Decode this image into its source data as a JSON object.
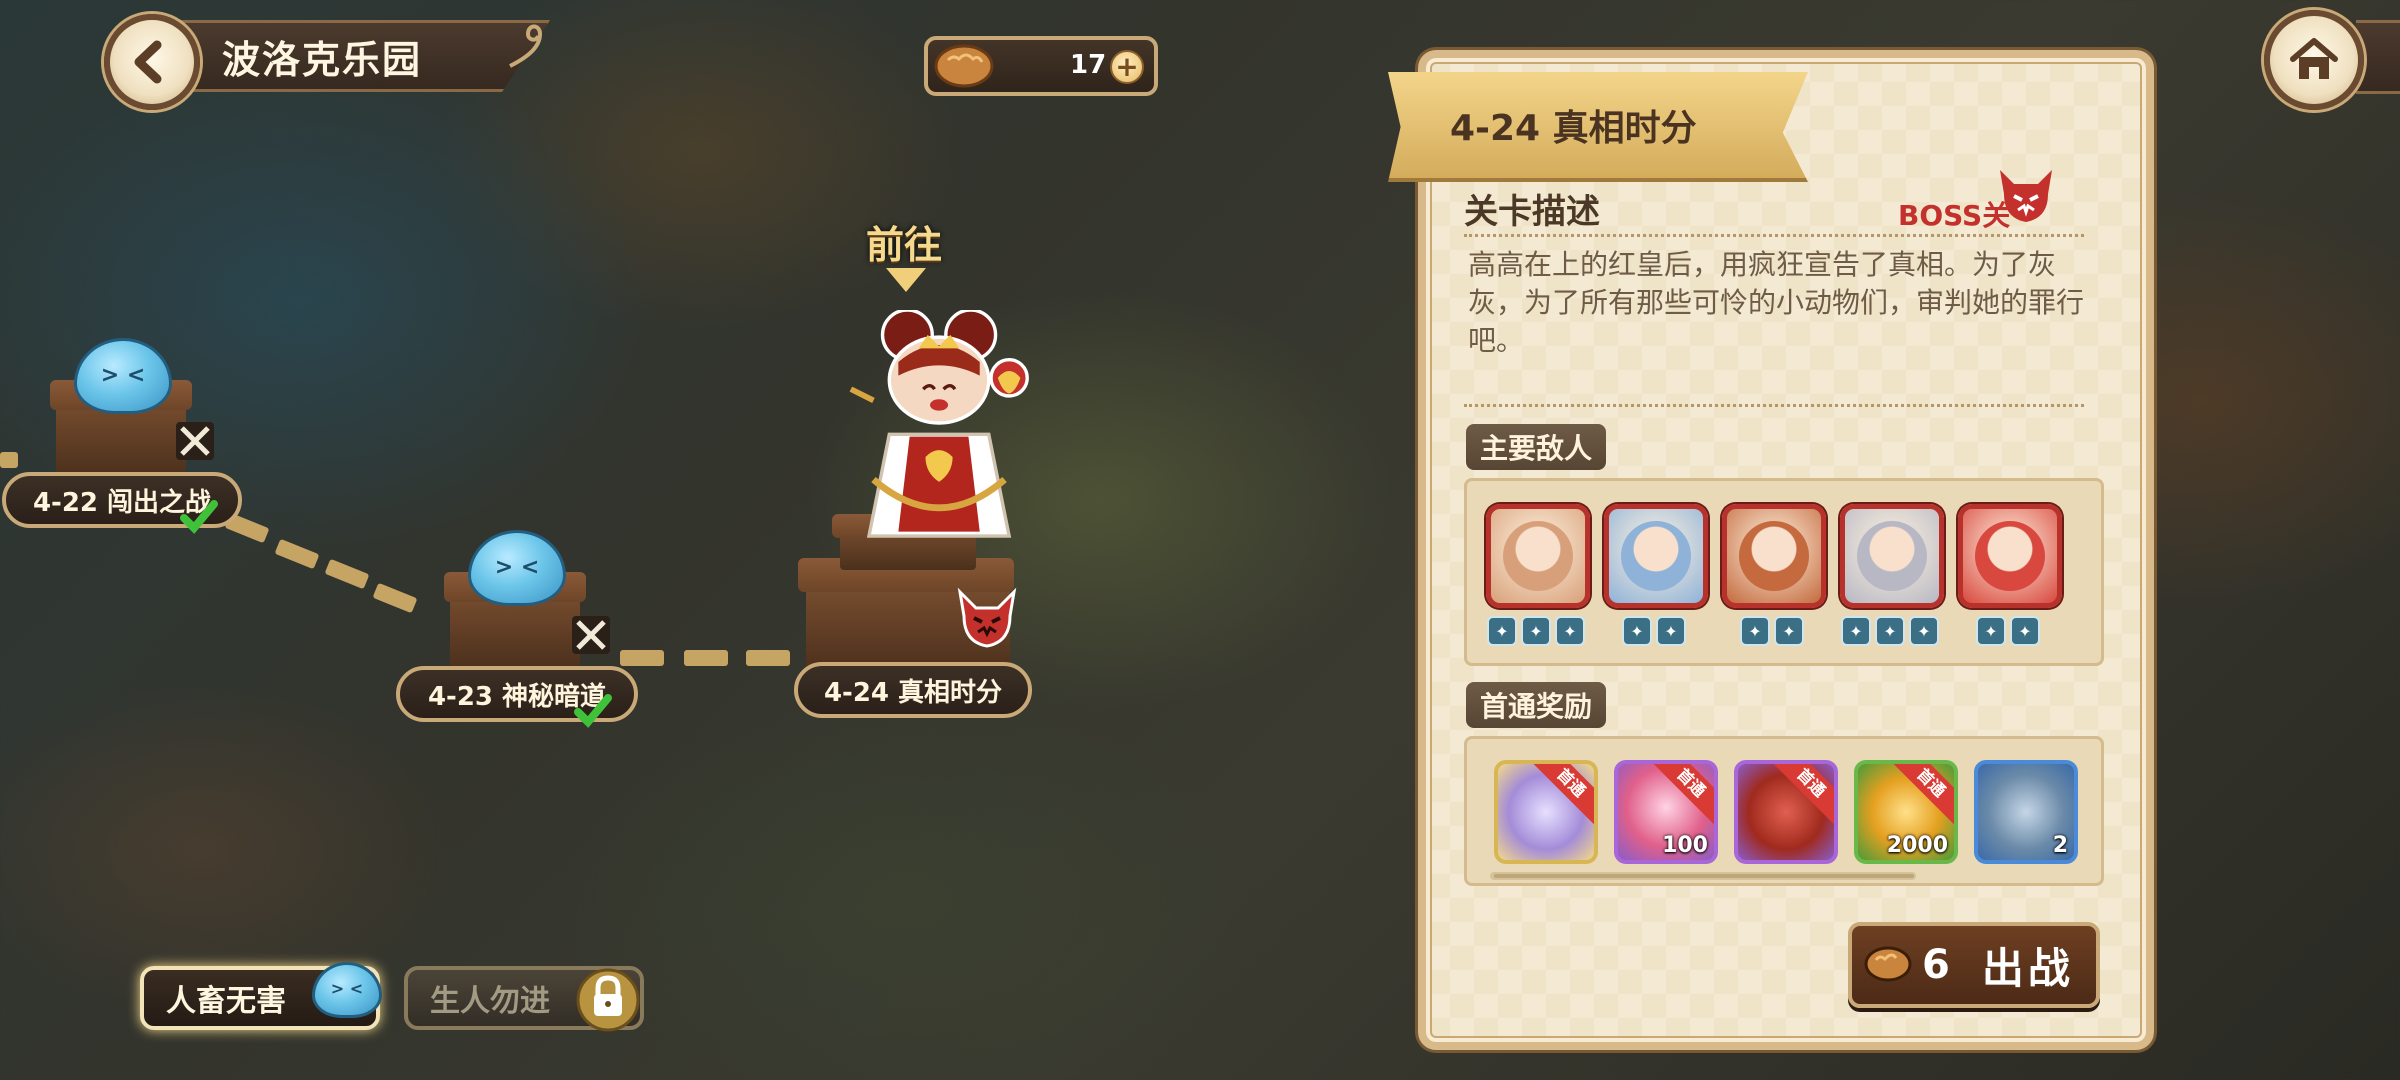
{
  "header": {
    "area_title": "波洛克乐园",
    "bread_count": "17"
  },
  "map": {
    "goto_label": "前往",
    "stages": [
      {
        "label": "4-22 闯出之战",
        "cleared": true
      },
      {
        "label": "4-23 神秘暗道",
        "cleared": true
      },
      {
        "label": "4-24 真相时分",
        "cleared": false,
        "boss": true
      }
    ]
  },
  "difficulty": {
    "active": "人畜无害",
    "locked": "生人勿进"
  },
  "panel": {
    "stage_title": "4-24 真相时分",
    "desc_title": "关卡描述",
    "boss_tag": "BOSS关",
    "description": "高高在上的红皇后，用疯狂宣告了真相。为了灰灰，为了所有那些可怜的小动物们，审判她的罪行吧。",
    "enemies_title": "主要敌人",
    "enemies": [
      {
        "name": "red-queen",
        "color": "#d8a07a",
        "badges": 3
      },
      {
        "name": "blue-mage",
        "color": "#8fb2d8",
        "badges": 2
      },
      {
        "name": "red-hood",
        "color": "#c46a3e",
        "badges": 2
      },
      {
        "name": "heart-knight",
        "color": "#b8b8c4",
        "badges": 3
      },
      {
        "name": "red-card-soldier",
        "color": "#d8483e",
        "badges": 2
      }
    ],
    "rewards_title": "首通奖励",
    "first_clear_tag": "首通",
    "rewards": [
      {
        "name": "crystal-scepter",
        "qty": "",
        "tag": true,
        "border": "#d8b654"
      },
      {
        "name": "pink-gem",
        "qty": "100",
        "tag": true,
        "border": "#a866d8"
      },
      {
        "name": "red-mask",
        "qty": "",
        "tag": true,
        "border": "#a866d8"
      },
      {
        "name": "gold-coin",
        "qty": "2000",
        "tag": true,
        "border": "#6ab84a"
      },
      {
        "name": "hammer",
        "qty": "2",
        "tag": false,
        "border": "#4a8ad8"
      }
    ],
    "battle_cost": "6",
    "battle_label": "出战"
  }
}
